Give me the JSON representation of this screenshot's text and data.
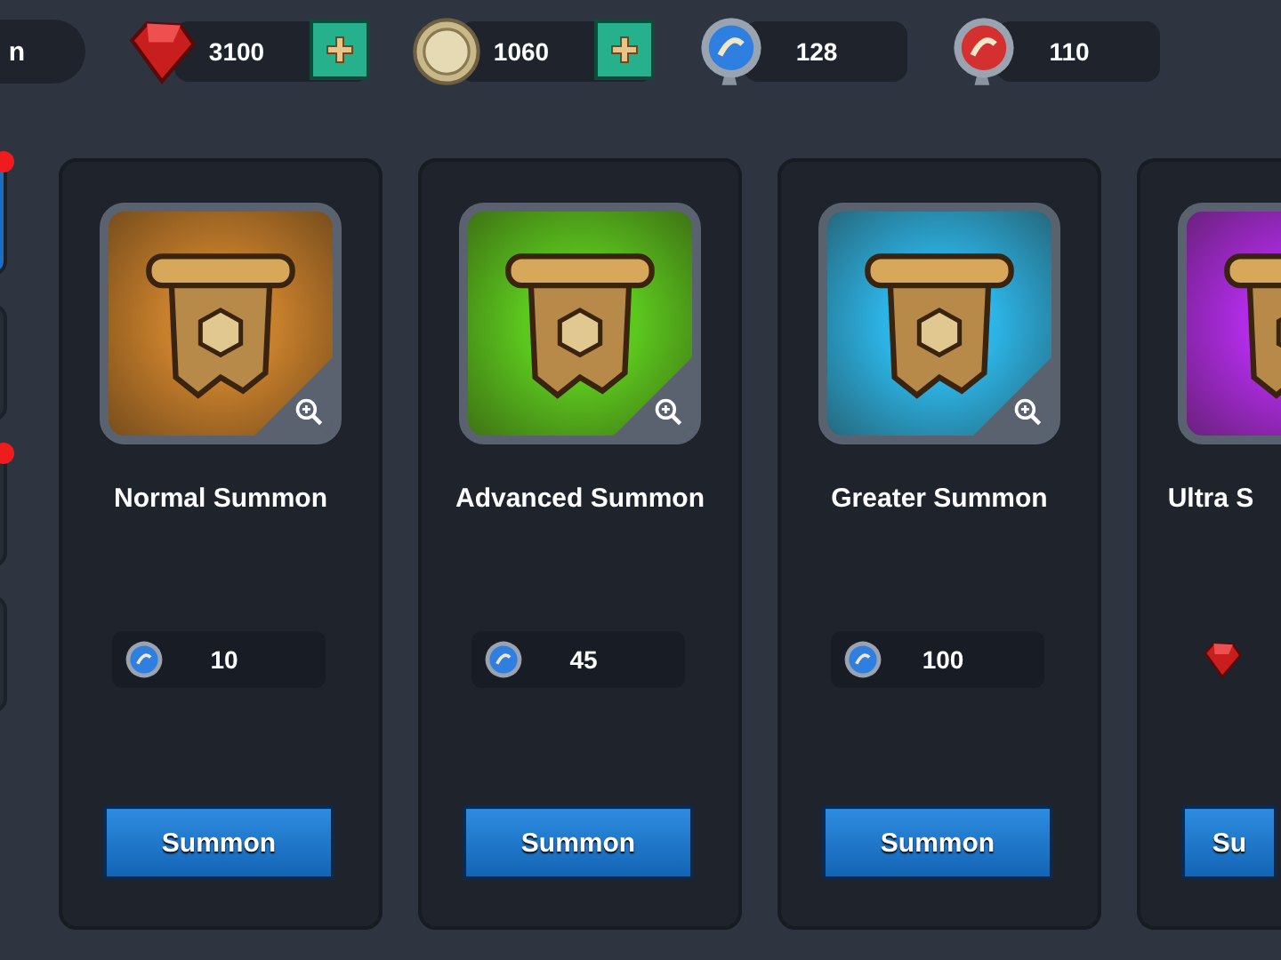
{
  "top_bar": {
    "tab_label": "n",
    "resources": [
      {
        "kind": "gem",
        "amount": "3100",
        "add_button": true
      },
      {
        "kind": "coin",
        "amount": "1060",
        "add_button": true
      },
      {
        "kind": "blue_token",
        "amount": "128",
        "add_button": false
      },
      {
        "kind": "red_token",
        "amount": "110",
        "add_button": false
      }
    ]
  },
  "sidebar": {
    "tabs": [
      {
        "selected": true,
        "badge": true
      },
      {
        "selected": false,
        "badge": false
      },
      {
        "selected": false,
        "badge": true
      },
      {
        "selected": false,
        "badge": false
      }
    ]
  },
  "cards": [
    {
      "title": "Normal Summon",
      "color": "#c8802c",
      "cost": {
        "kind": "blue_token",
        "amount": "10"
      },
      "button": "Summon"
    },
    {
      "title": "Advanced Summon",
      "color": "#5cc81e",
      "cost": {
        "kind": "blue_token",
        "amount": "45"
      },
      "button": "Summon"
    },
    {
      "title": "Greater Summon",
      "color": "#2cb4e6",
      "cost": {
        "kind": "blue_token",
        "amount": "100"
      },
      "button": "Summon"
    },
    {
      "title": "Ultra S",
      "color": "#b02ce6",
      "cost": {
        "kind": "gem"
      },
      "button": "Su"
    }
  ]
}
